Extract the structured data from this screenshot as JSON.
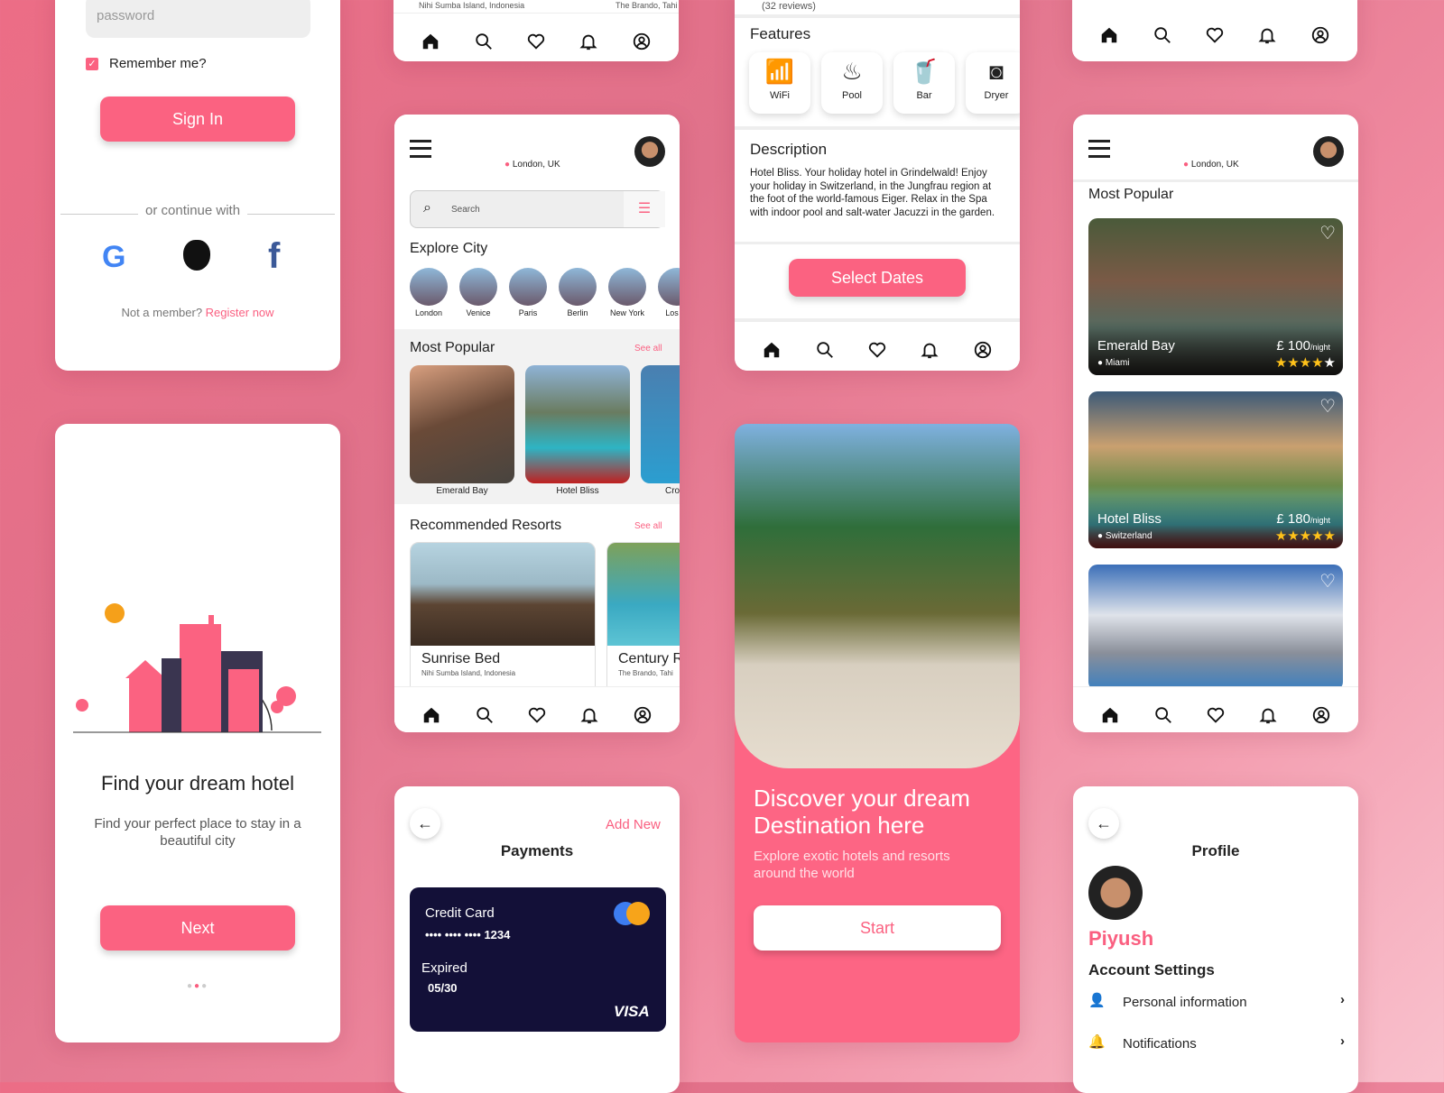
{
  "colors": {
    "accent": "#fb6281",
    "card_dark": "#131038",
    "star": "#ffc21a"
  },
  "login": {
    "password_placeholder": "password",
    "remember": "Remember me?",
    "remember_checked": true,
    "sign_in": "Sign In",
    "or_continue": "or continue with",
    "social": [
      "google-icon",
      "apple-icon",
      "facebook-icon"
    ],
    "not_member": "Not a member?",
    "register": "Register now"
  },
  "onboarding": {
    "title": "Find your dream hotel",
    "subtitle": "Find your perfect place to stay in a beautiful city",
    "next": "Next",
    "page_index": 2,
    "page_count": 3
  },
  "nav_items": [
    "home",
    "search",
    "favorites",
    "notifications",
    "profile"
  ],
  "top_cut": {
    "resort1_location": "Nihi Sumba Island, Indonesia",
    "resort2_location": "The Brando, Tahi"
  },
  "home": {
    "location": "London, UK",
    "search_placeholder": "Search",
    "explore": "Explore City",
    "cities": [
      "London",
      "Venice",
      "Paris",
      "Berlin",
      "New York",
      "Los Ar"
    ],
    "most_popular": "Most Popular",
    "see_all": "See all",
    "popular": [
      "Emerald Bay",
      "Hotel Bliss",
      "Cro"
    ],
    "recommended": "Recommended Resorts",
    "resorts": [
      {
        "name": "Sunrise Bed",
        "location": "Nihi Sumba Island, Indonesia"
      },
      {
        "name": "Century R",
        "location": "The Brando, Tahi"
      }
    ]
  },
  "details": {
    "reviews": "(32 reviews)",
    "features_title": "Features",
    "features": [
      {
        "icon": "wifi-icon",
        "label": "WiFi"
      },
      {
        "icon": "pool-icon",
        "label": "Pool"
      },
      {
        "icon": "bar-icon",
        "label": "Bar"
      },
      {
        "icon": "dryer-icon",
        "label": "Dryer"
      }
    ],
    "description_title": "Description",
    "description": "Hotel Bliss. Your holiday hotel in Grindelwald! Enjoy your holiday in Switzerland, in the Jungfrau region at the foot of the world-famous Eiger. Relax in the Spa with indoor pool and salt-water Jacuzzi in the garden.",
    "select_dates": "Select Dates"
  },
  "discover": {
    "title": "Discover your dream Destination here",
    "subtitle": "Explore exotic hotels and resorts around the world",
    "start": "Start"
  },
  "payments": {
    "add_new": "Add New",
    "title": "Payments",
    "card_type": "Credit Card",
    "card_number": "•••• •••• •••• 1234",
    "expired_label": "Expired",
    "expiry": "05/30",
    "brand": "VISA"
  },
  "popular_list": {
    "location": "London, UK",
    "title": "Most Popular",
    "hotels": [
      {
        "name": "Emerald Bay",
        "location": "Miami",
        "price": "£ 100",
        "unit": "/night",
        "rating": 4.5
      },
      {
        "name": "Hotel Bliss",
        "location": "Switzerland",
        "price": "£ 180",
        "unit": "/night",
        "rating": 5
      }
    ]
  },
  "profile": {
    "title": "Profile",
    "name": "Piyush",
    "account_settings": "Account Settings",
    "items": [
      "Personal information",
      "Notifications"
    ]
  }
}
